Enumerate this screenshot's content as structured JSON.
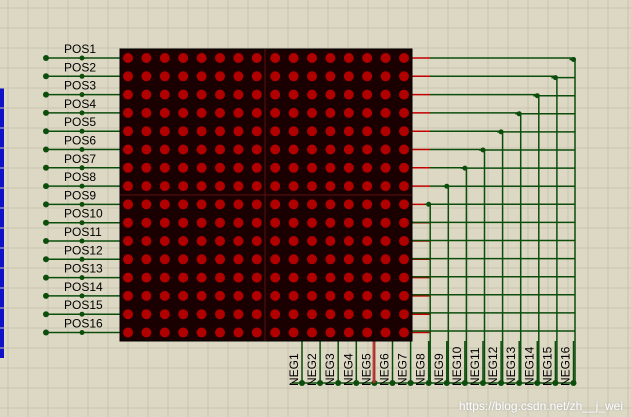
{
  "matrix": {
    "rows": 16,
    "cols": 16,
    "colors": {
      "body": "#1a0000",
      "led": "#b00000",
      "wire": "#0c4d0c",
      "pin": "#c00000",
      "background": "#dcd8c4",
      "grid": "#c8c4ae",
      "label": "#000000"
    }
  },
  "pos_labels": [
    "POS1",
    "POS2",
    "POS3",
    "POS4",
    "POS5",
    "POS6",
    "POS7",
    "POS8",
    "POS9",
    "POS10",
    "POS11",
    "POS12",
    "POS13",
    "POS14",
    "POS15",
    "POS16"
  ],
  "neg_labels": [
    "NEG1",
    "NEG2",
    "NEG3",
    "NEG4",
    "NEG5",
    "NEG6",
    "NEG7",
    "NEG8",
    "NEG9",
    "NEG10",
    "NEG11",
    "NEG12",
    "NEG13",
    "NEG14",
    "NEG15",
    "NEG16"
  ],
  "watermark": "https://blog.csdn.net/zh__j_wei"
}
